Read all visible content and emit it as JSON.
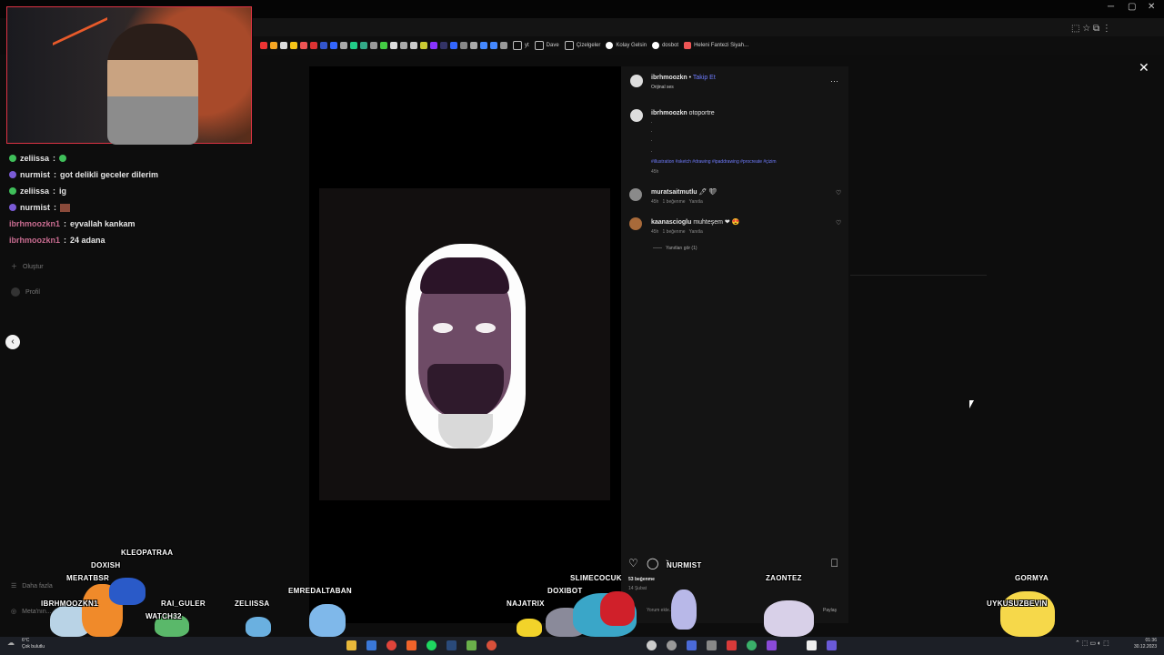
{
  "window": {
    "minimize": "─",
    "maximize": "▢",
    "close": "✕"
  },
  "bookmarks": [
    "yt",
    "Dave",
    "Çizelgeler",
    "Kolay Gelsin",
    "dosbot",
    "Heleni Fantezi Siyah..."
  ],
  "chat": [
    {
      "user": "zeliissa",
      "msg": "",
      "color": "#e6e6e6",
      "badge": "#3fbf5a"
    },
    {
      "user": "nurmist",
      "msg": "got delikli geceler dilerim",
      "color": "#e6e6e6",
      "badge": "#7a5bd6"
    },
    {
      "user": "zeliissa",
      "msg": "ig",
      "color": "#e6e6e6",
      "badge": "#3fbf5a"
    },
    {
      "user": "nurmist",
      "msg": "",
      "color": "#e6e6e6",
      "badge": "#7a5bd6"
    },
    {
      "user": "ibrhmoozkn1",
      "msg": "eyvallah kankam",
      "color": "#c76b8f",
      "badge": ""
    },
    {
      "user": "ibrhmoozkn1",
      "msg": "24 adana",
      "color": "#c76b8f",
      "badge": ""
    }
  ],
  "sidebar": {
    "create": "Oluştur",
    "profile": "Profil",
    "more": "Daha fazla",
    "meta": "Meta'nın..."
  },
  "post": {
    "author": "ibrhmoozkn",
    "follow": "Takip Et",
    "audio": "Orijinal ses",
    "caption_user": "ibrhmoozkn",
    "caption": "otoportre",
    "dots": [
      ".",
      ".",
      ".",
      "."
    ],
    "hashtags": "#illustration #sketch #drawing #ipaddrawing #procreate #çizim",
    "caption_time": "45h",
    "comments": [
      {
        "user": "muratsaitmutlu",
        "text": "🖊 ❤",
        "time": "45h",
        "likes": "1 beğenme",
        "reply": "Yanıtla"
      },
      {
        "user": "kaanascioglu",
        "text": "muhteşem ❤ 😍",
        "time": "45h",
        "likes": "1 beğenme",
        "reply": "Yanıtla"
      }
    ],
    "view_replies": "Yanıtları gör (1)",
    "likes": "53 beğenme",
    "date": "14 Şubat",
    "comment_placeholder": "Yorum ekle...",
    "share": "Paylaş"
  },
  "overlay_names": {
    "n1": "KLEOPATRAA",
    "n2": "DOXISH",
    "n3": "MERATBSR",
    "n4": "IBRHMOOZKN1",
    "n5": "RAI_GULER",
    "n6": "WATCH32",
    "n7": "ZELIISSA",
    "n8": "EMREDALTABAN",
    "n9": "NAJATRIX",
    "n10": "DOXIBOT",
    "n11": "SLIMECOCUK",
    "n12": "NURMIST",
    "n13": "ZAONTEZ",
    "n14": "GORMYA",
    "n15": "UYKUSUZBEVIN"
  },
  "taskbar": {
    "weather_temp": "6°C",
    "weather_desc": "Çok bulutlu",
    "time": "01:36",
    "date": "30.12.2023"
  },
  "colors": {
    "link": "#6f7cff",
    "panel": "#141414",
    "accent": "#3fbf5a"
  }
}
